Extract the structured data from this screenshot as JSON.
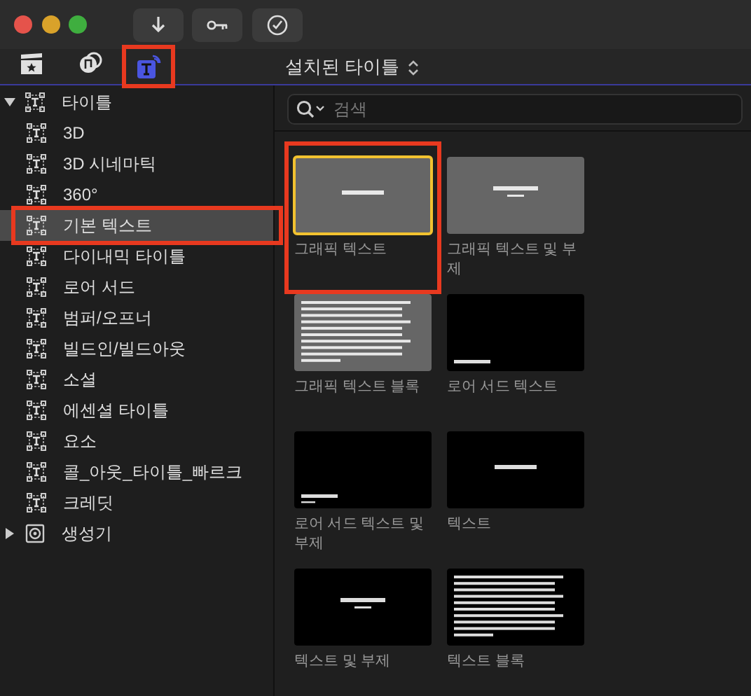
{
  "browser_tabs": [
    {
      "selected": false,
      "highlighted": false
    },
    {
      "selected": false,
      "highlighted": false
    },
    {
      "selected": true,
      "highlighted": true
    }
  ],
  "category_menu": {
    "label": "설치된 타이틀"
  },
  "sidebar": {
    "items": [
      {
        "label": "타이틀",
        "expanded": true,
        "selected": false,
        "highlighted": false,
        "kind": "title",
        "children": [
          {
            "label": "3D",
            "selected": false,
            "highlighted": false,
            "kind": "title"
          },
          {
            "label": "3D 시네마틱",
            "selected": false,
            "highlighted": false,
            "kind": "title"
          },
          {
            "label": "360°",
            "selected": false,
            "highlighted": false,
            "kind": "title"
          },
          {
            "label": "기본 텍스트",
            "selected": true,
            "highlighted": true,
            "kind": "title"
          },
          {
            "label": "다이내믹 타이틀",
            "selected": false,
            "highlighted": false,
            "kind": "title"
          },
          {
            "label": "로어 서드",
            "selected": false,
            "highlighted": false,
            "kind": "title"
          },
          {
            "label": "범퍼/오프너",
            "selected": false,
            "highlighted": false,
            "kind": "title"
          },
          {
            "label": "빌드인/빌드아웃",
            "selected": false,
            "highlighted": false,
            "kind": "title"
          },
          {
            "label": "소셜",
            "selected": false,
            "highlighted": false,
            "kind": "title"
          },
          {
            "label": "에센셜 타이틀",
            "selected": false,
            "highlighted": false,
            "kind": "title"
          },
          {
            "label": "요소",
            "selected": false,
            "highlighted": false,
            "kind": "title"
          },
          {
            "label": "콜_아웃_타이틀_빠르크",
            "selected": false,
            "highlighted": false,
            "kind": "title"
          },
          {
            "label": "크레딧",
            "selected": false,
            "highlighted": false,
            "kind": "title"
          }
        ]
      },
      {
        "label": "생성기",
        "expanded": false,
        "selected": false,
        "highlighted": false,
        "kind": "generator"
      }
    ]
  },
  "search": {
    "placeholder": "검색"
  },
  "tiles": [
    {
      "label": "그래픽 텍스트",
      "kind": "headline",
      "color": "#666666",
      "selected": true,
      "highlighted": true
    },
    {
      "label": "그래픽 텍스트 및 부제",
      "kind": "subtitled",
      "color": "#666666",
      "selected": false,
      "highlighted": false
    },
    {
      "label": "그래픽 텍스트 블록",
      "kind": "paragraph",
      "color": "#666666",
      "selected": false,
      "highlighted": false
    },
    {
      "label": "로어 서드 텍스트",
      "kind": "lowerthird",
      "color": "#000000",
      "selected": false,
      "highlighted": false
    },
    {
      "label": "로어 서드 텍스트 및 부제",
      "kind": "lowersubtitled",
      "color": "#000000",
      "selected": false,
      "highlighted": false
    },
    {
      "label": "텍스트",
      "kind": "headline",
      "color": "#000000",
      "selected": false,
      "highlighted": false
    },
    {
      "label": "텍스트 및 부제",
      "kind": "subtitled",
      "color": "#000000",
      "selected": false,
      "highlighted": false
    },
    {
      "label": "텍스트 블록",
      "kind": "paragraph",
      "color": "#000000",
      "selected": false,
      "highlighted": false
    }
  ]
}
